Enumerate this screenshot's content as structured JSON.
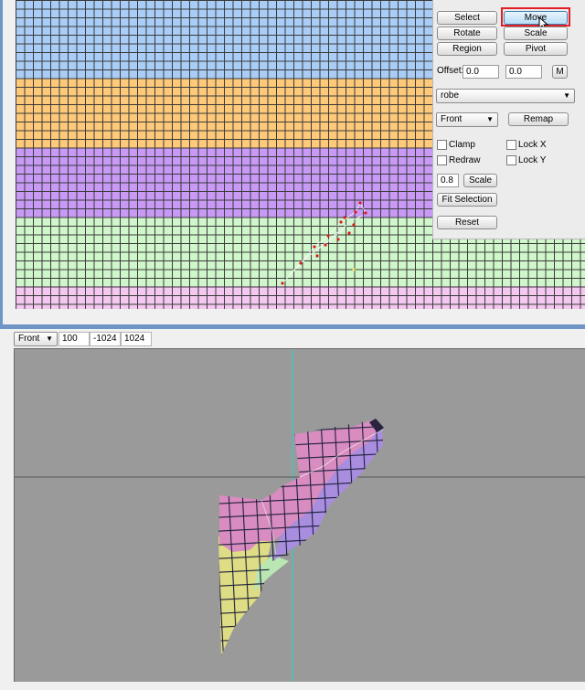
{
  "uv_panel": {
    "buttons": {
      "select": "Select",
      "move": "Move",
      "rotate": "Rotate",
      "scale": "Scale",
      "region": "Region",
      "pivot": "Pivot",
      "m": "M",
      "remap": "Remap",
      "scale_small": "Scale",
      "fit_selection": "Fit Selection",
      "reset": "Reset"
    },
    "offset": {
      "label": "Offset:",
      "x": "0.0",
      "y": "0.0"
    },
    "object_select": "robe",
    "view_select": "Front",
    "checkboxes": {
      "clamp": "Clamp",
      "lock_x": "Lock X",
      "redraw": "Redraw",
      "lock_y": "Lock Y"
    },
    "scale_value": "0.8"
  },
  "viewport_toolbar": {
    "view": "Front",
    "field1": "100",
    "field2": "-1024",
    "field3": "1024"
  },
  "colors": {
    "uv_blue": "#a9cdf7",
    "uv_orange": "#fec979",
    "uv_purple": "#c89af6",
    "uv_green": "#d0f7cb",
    "uv_pink": "#f4c8f0",
    "viewport_bg": "#9a9a9a",
    "axis_cyan": "#33cccc",
    "highlight_red": "#e21f27"
  }
}
